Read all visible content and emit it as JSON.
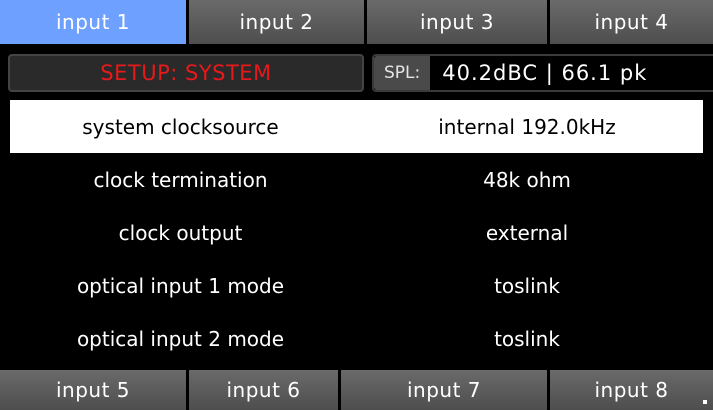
{
  "top_tabs": [
    {
      "label": "input 1",
      "active": true
    },
    {
      "label": "input 2",
      "active": false
    },
    {
      "label": "input 3",
      "active": false
    },
    {
      "label": "input 4",
      "active": false
    }
  ],
  "bottom_tabs": [
    {
      "label": "input 5"
    },
    {
      "label": "input 6"
    },
    {
      "label": "input 7"
    },
    {
      "label": "input 8"
    }
  ],
  "header": {
    "title": "SETUP: SYSTEM",
    "spl_label": "SPL:",
    "spl_value": "40.2dBC |  66.1 pk"
  },
  "settings": [
    {
      "label": "system clocksource",
      "value": "internal 192.0kHz",
      "selected": true
    },
    {
      "label": "clock termination",
      "value": "48k ohm",
      "selected": false
    },
    {
      "label": "clock output",
      "value": "external",
      "selected": false
    },
    {
      "label": "optical input 1 mode",
      "value": "toslink",
      "selected": false
    },
    {
      "label": "optical input 2 mode",
      "value": "toslink",
      "selected": false
    }
  ],
  "colors": {
    "active_tab": "#6ea0ff",
    "title_red": "#e8191a",
    "background": "#000000"
  }
}
